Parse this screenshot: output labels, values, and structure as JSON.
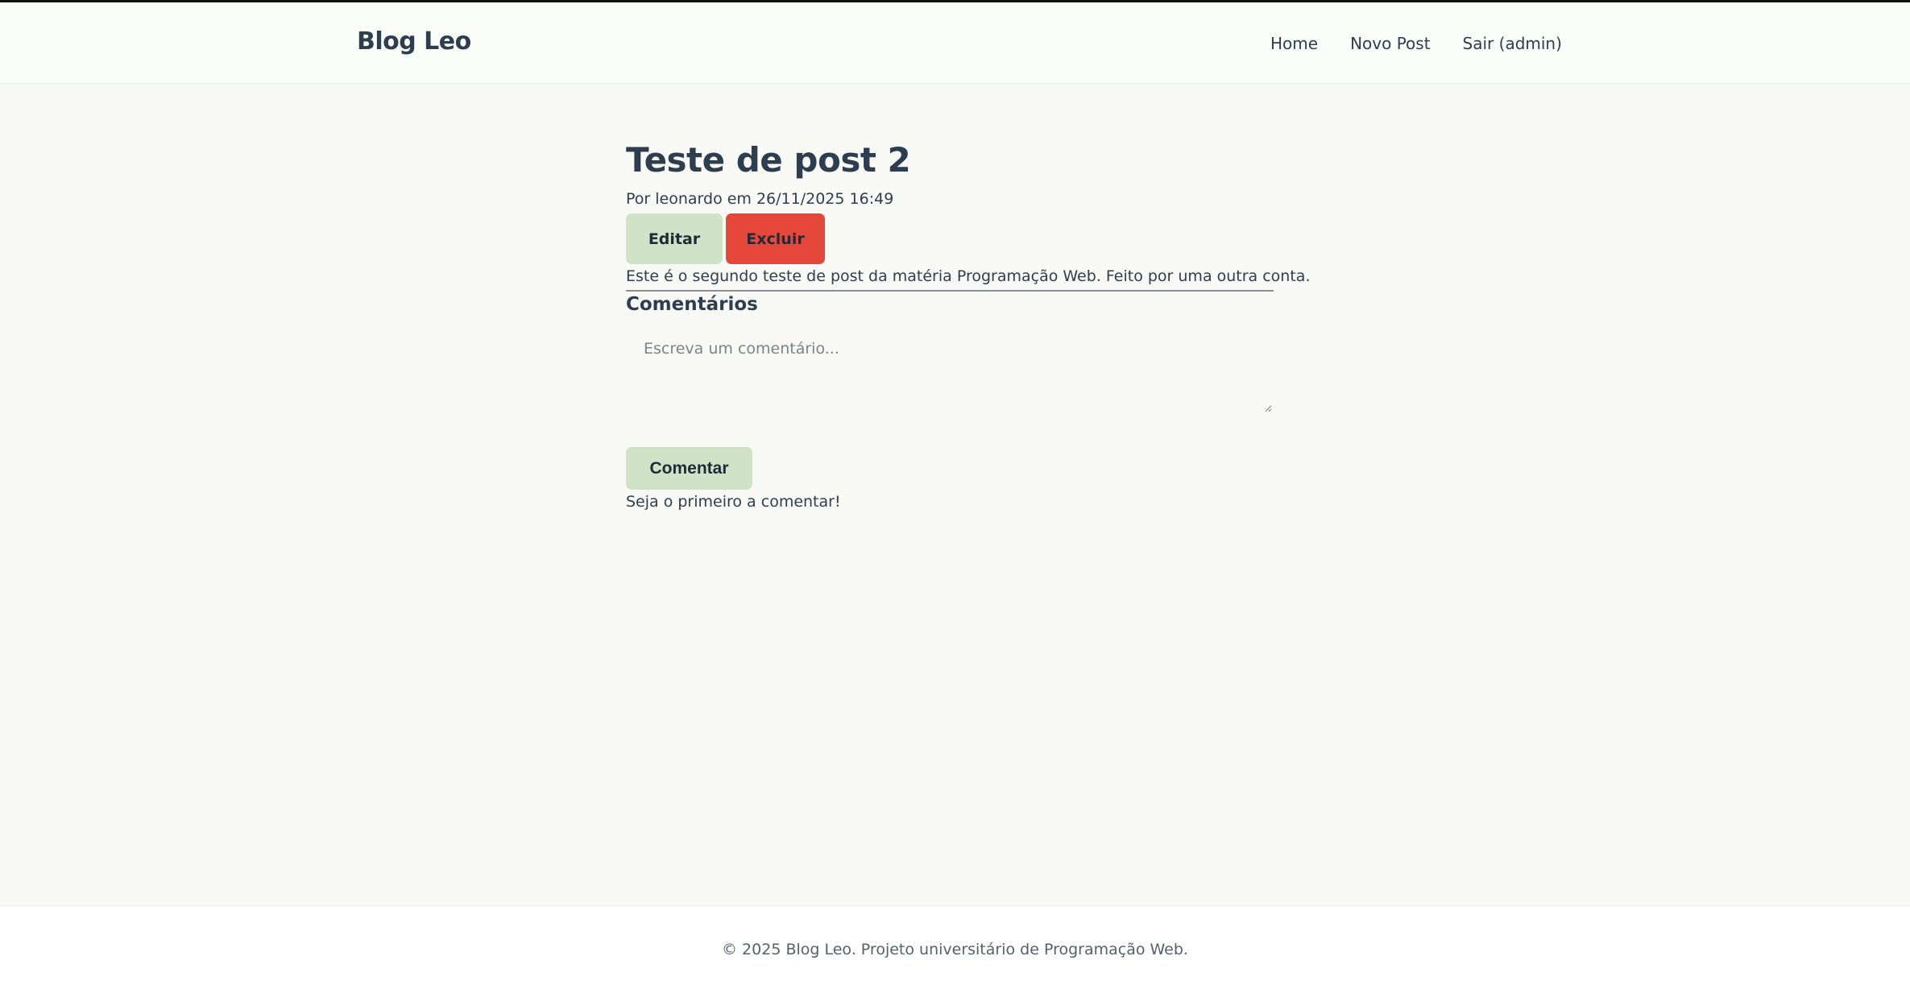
{
  "header": {
    "brand": "Blog Leo",
    "nav": {
      "home": "Home",
      "new_post": "Novo Post",
      "logout": "Sair (admin)"
    }
  },
  "post": {
    "title": "Teste de post 2",
    "meta": "Por leonardo em 26/11/2025 16:49",
    "edit_label": "Editar",
    "delete_label": "Excluir",
    "body": "Este é o segundo teste de post da matéria Programação Web. Feito por uma outra conta."
  },
  "comments": {
    "heading": "Comentários",
    "placeholder": "Escreva um comentário...",
    "submit_label": "Comentar",
    "empty_text": "Seja o primeiro a comentar!"
  },
  "footer": {
    "text": "© 2025 Blog Leo. Projeto universitário de Programação Web."
  },
  "colors": {
    "background": "#f9f9f5",
    "text": "#2d3e50",
    "edit_button": "#d1e3c7",
    "delete_button": "#e5473b",
    "comment_button": "#d1e3c7"
  }
}
